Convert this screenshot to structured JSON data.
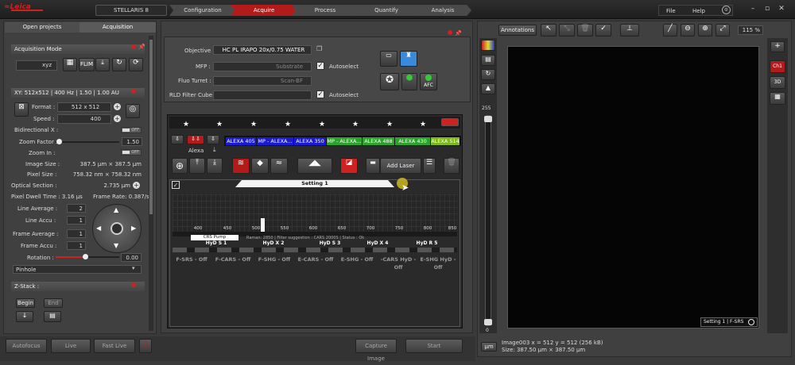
{
  "topbar": {
    "system": "STELLARIS 8",
    "workflow": [
      "Configuration",
      "Acquire",
      "Process",
      "Quantify",
      "Analysis"
    ],
    "menu": [
      "File",
      "Help"
    ]
  },
  "left": {
    "tabs": [
      "Open projects",
      "Acquisition"
    ],
    "acq_mode": {
      "title": "Acquisition Mode",
      "mode": "xyz",
      "flim": "FLIM"
    },
    "xy": {
      "title": "XY: 512x512 | 400 Hz | 1.50 | 1.00 AU",
      "format_label": "Format :",
      "format": "512 x 512",
      "speed_label": "Speed :",
      "speed": "400",
      "bidir_label": "Bidirectional X :",
      "toggle_off": "OFF",
      "zoom_factor_label": "Zoom Factor :",
      "zoom_factor": "1.50",
      "zoom_in_label": "Zoom In :",
      "image_size_label": "Image Size :",
      "image_size": "387.5 µm × 387.5 µm",
      "pixel_size_label": "Pixel Size :",
      "pixel_size": "758.32 nm × 758.32 nm",
      "optical_section_label": "Optical Section :",
      "optical_section": "2.735 µm",
      "pixel_dwell": "Pixel Dwell Time : 3.16 µs",
      "frame_rate": "Frame Rate: 0.387/s",
      "line_avg_label": "Line Average :",
      "line_avg": "2",
      "line_accu_label": "Line Accu :",
      "line_accu": "1",
      "frame_avg_label": "Frame Average :",
      "frame_avg": "1",
      "frame_accu_label": "Frame Accu :",
      "frame_accu": "1",
      "rotation_label": "Rotation :",
      "rotation": "0.00",
      "pinhole": "Pinhole"
    },
    "zstack": {
      "title": "Z-Stack :",
      "begin": "Begin",
      "end": "End"
    }
  },
  "center": {
    "objective_label": "Objective :",
    "objective": "HC PL IRAPO    20x/0.75 WATER",
    "mfp_label": "MFP :",
    "mfp": "Substrate",
    "fluo_label": "Fluo Turret :",
    "fluo": "Scan-BF",
    "rld_label": "RLD Filter Cube :",
    "autoselect": "Autoselect",
    "afc": "AFC",
    "lasers": [
      {
        "label": "ALEXA 405",
        "color": "#1a1ad0"
      },
      {
        "label": "MP - ALEXA...",
        "color": "#1a1ad0"
      },
      {
        "label": "ALEXA 350",
        "color": "#1a1ad0"
      },
      {
        "label": "MP - ALEXA...",
        "color": "#2aa52a"
      },
      {
        "label": "ALEXA 488",
        "color": "#2aa52a"
      },
      {
        "label": "ALEXA 430",
        "color": "#2aa52a"
      },
      {
        "label": "ALEXA 514",
        "color": "#7fb81a"
      }
    ],
    "alexa": "Alexa",
    "add_laser": "Add Laser",
    "setting": "Setting 1",
    "ticks": [
      "400",
      "450",
      "500",
      "550",
      "600",
      "650",
      "700",
      "750",
      "800",
      "850"
    ],
    "crs_pump": "CRS Pump",
    "raman": "Raman: 2850 | Filter suggestion : CARS 2000S | Status : Ok",
    "detectors": [
      "HyD S 1",
      "HyD X 2",
      "HyD S 3",
      "HyD X 4",
      "HyD R 5"
    ],
    "det_off": [
      "F-SRS - Off",
      "F-CARS - Off",
      "F-SHG - Off",
      "E-CARS - Off",
      "E-SHG - Off",
      "-CARS HyD - Off",
      "E-SHG HyD - Off"
    ]
  },
  "right": {
    "annotations": "Annotations",
    "zoom": "115 %",
    "ch": "Ch1",
    "threed": "3D",
    "scale_top": "255",
    "scale_bottom": "0",
    "overlay": "Setting 1 | F-SRS",
    "um": "µm",
    "info1": "Image003   x = 512  y = 512  (256 kB)",
    "info2": "Size: 387.50 µm × 387.50 µm"
  },
  "bottom": {
    "autofocus": "Autofocus",
    "live": "Live",
    "fast_live": "Fast Live",
    "capture": "Capture Image",
    "start": "Start"
  }
}
